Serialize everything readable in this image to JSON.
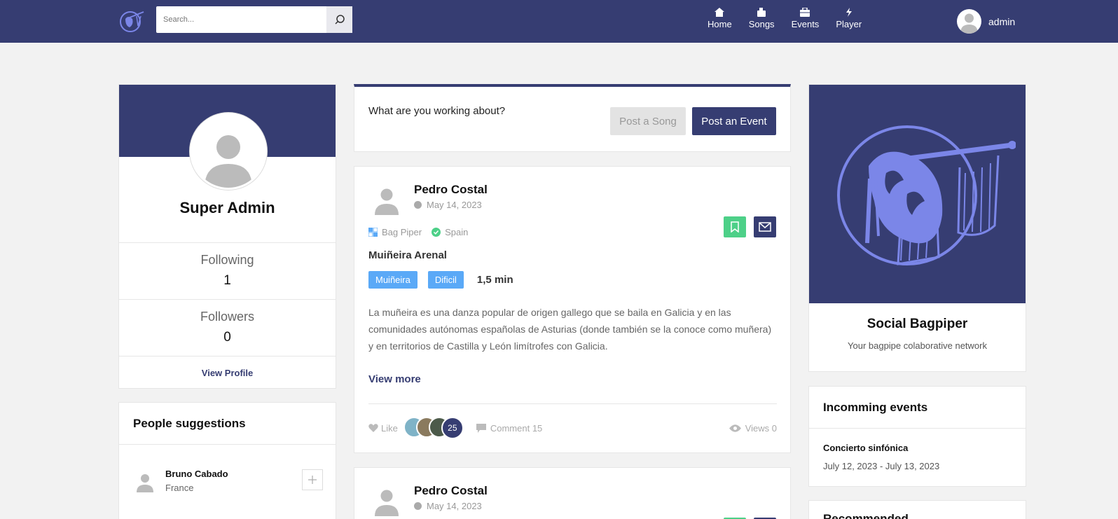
{
  "header": {
    "search_placeholder": "Search...",
    "nav": [
      {
        "label": "Home",
        "icon": "home-icon"
      },
      {
        "label": "Songs",
        "icon": "songs-icon"
      },
      {
        "label": "Events",
        "icon": "events-icon"
      },
      {
        "label": "Player",
        "icon": "player-icon"
      }
    ],
    "username": "admin"
  },
  "profile": {
    "name": "Super Admin",
    "following_label": "Following",
    "following_count": "1",
    "followers_label": "Followers",
    "followers_count": "0",
    "view_profile": "View Profile"
  },
  "suggestions": {
    "title": "People suggestions",
    "people": [
      {
        "name": "Bruno Cabado",
        "country": "France"
      }
    ]
  },
  "compose": {
    "prompt": "What are you working about?",
    "post_song": "Post a Song",
    "post_event": "Post an Event"
  },
  "posts": [
    {
      "author": "Pedro Costal",
      "date": "May 14, 2023",
      "instrument": "Bag Piper",
      "country": "Spain",
      "song_title": "Muiñeira Arenal",
      "tags": [
        "Muiñeira",
        "Dificil"
      ],
      "duration": "1,5 min",
      "body": "La muñeira es una danza popular de origen gallego que se baila en Galicia y en las comunidades autónomas españolas de Asturias (donde también se la conoce como muñera) y en territorios de Castilla y León limítrofes con Galicia.",
      "view_more": "View more",
      "like_label": "Like",
      "likes_count": "25",
      "comment_label": "Comment 15",
      "views_label": "Views 0"
    },
    {
      "author": "Pedro Costal",
      "date": "May 14, 2023"
    }
  ],
  "brand": {
    "name": "Social Bagpiper",
    "tagline": "Your bagpipe colaborative network"
  },
  "events": {
    "title": "Incomming events",
    "items": [
      {
        "name": "Concierto sinfónica",
        "dates": "July 12, 2023 - July 13, 2023"
      }
    ]
  },
  "recommended": {
    "title": "Recommended"
  },
  "colors": {
    "brand": "#363d72",
    "accent": "#5aa9f7",
    "save": "#4dd088",
    "background": "#f2f2f2"
  }
}
